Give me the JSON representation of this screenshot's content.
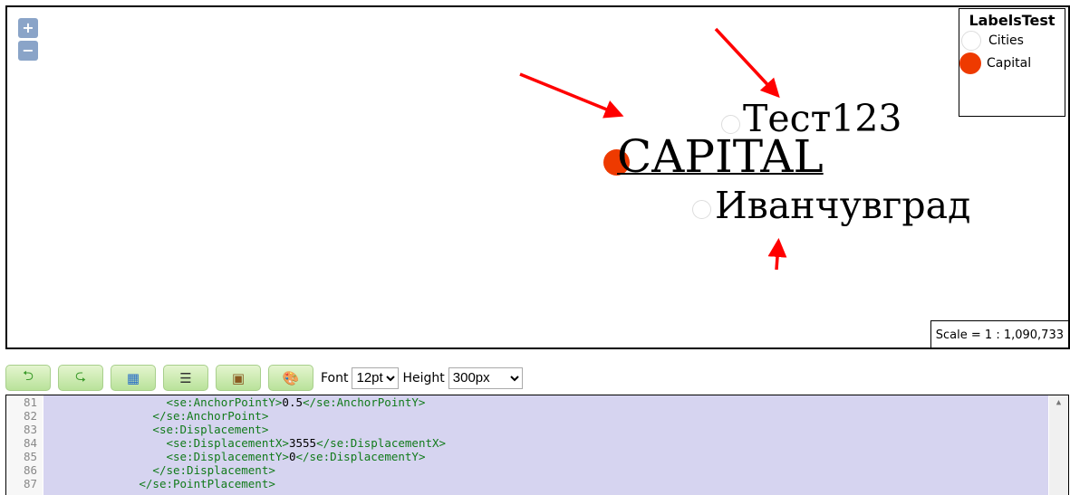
{
  "map": {
    "zoom_in": "+",
    "zoom_out": "−",
    "labels": [
      {
        "text": "Тест123",
        "layer": "Cities"
      },
      {
        "text": "CAPITAL",
        "layer": "Capital"
      },
      {
        "text": "Иванчувград",
        "layer": "Cities"
      }
    ],
    "legend": {
      "title": "LabelsTest",
      "items": [
        {
          "label": "Cities",
          "color": "#ffffff"
        },
        {
          "label": "Capital",
          "color": "#ee3a00"
        }
      ]
    },
    "scale": "Scale = 1 : 1,090,733",
    "annotation_color": "#ff0000"
  },
  "toolbar": {
    "buttons": [
      {
        "icon": "undo-icon"
      },
      {
        "icon": "redo-icon"
      },
      {
        "icon": "apply-style-icon"
      },
      {
        "icon": "format-icon"
      },
      {
        "icon": "image-icon"
      },
      {
        "icon": "palette-icon"
      }
    ],
    "font_label": "Font",
    "font_value": "12pt",
    "height_label": "Height",
    "height_value": "300px"
  },
  "editor": {
    "lines": [
      {
        "n": "81",
        "indent": "        ",
        "open": "<se:AnchorPointY>",
        "value": "0.5",
        "close": "</se:AnchorPointY>"
      },
      {
        "n": "82",
        "indent": "      ",
        "open": "</se:AnchorPoint>",
        "value": "",
        "close": ""
      },
      {
        "n": "83",
        "indent": "      ",
        "open": "<se:Displacement>",
        "value": "",
        "close": ""
      },
      {
        "n": "84",
        "indent": "        ",
        "open": "<se:DisplacementX>",
        "value": "3555",
        "close": "</se:DisplacementX>"
      },
      {
        "n": "85",
        "indent": "        ",
        "open": "<se:DisplacementY>",
        "value": "0",
        "close": "</se:DisplacementY>"
      },
      {
        "n": "86",
        "indent": "      ",
        "open": "</se:Displacement>",
        "value": "",
        "close": ""
      },
      {
        "n": "87",
        "indent": "    ",
        "open": "</se:PointPlacement>",
        "value": "",
        "close": ""
      }
    ]
  }
}
